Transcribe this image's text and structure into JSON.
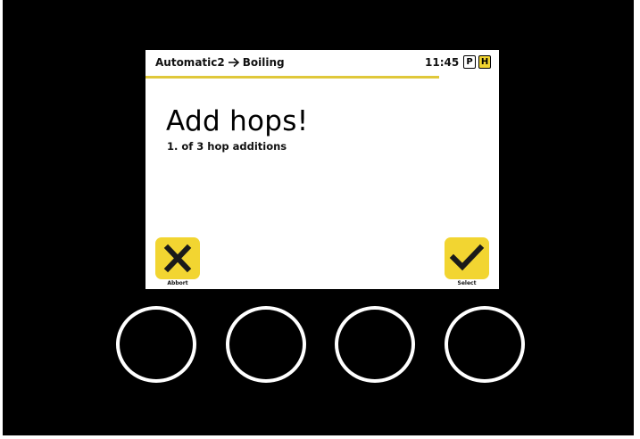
{
  "header": {
    "mode": "Automatic2",
    "arrow_icon": "arrow-right-icon",
    "step": "Boiling",
    "time": "11:45",
    "badges": [
      "P",
      "H"
    ]
  },
  "progress": {
    "fraction": 0.83,
    "color": "#e0c83a"
  },
  "main": {
    "title": "Add hops!",
    "subtitle": "1. of 3 hop additions"
  },
  "softkeys": {
    "left": {
      "label": "Abbort",
      "icon": "close-icon"
    },
    "right": {
      "label": "Select",
      "icon": "checkmark-icon"
    }
  },
  "colors": {
    "accent": "#f2d531",
    "bezel": "#000000",
    "screen": "#ffffff"
  }
}
